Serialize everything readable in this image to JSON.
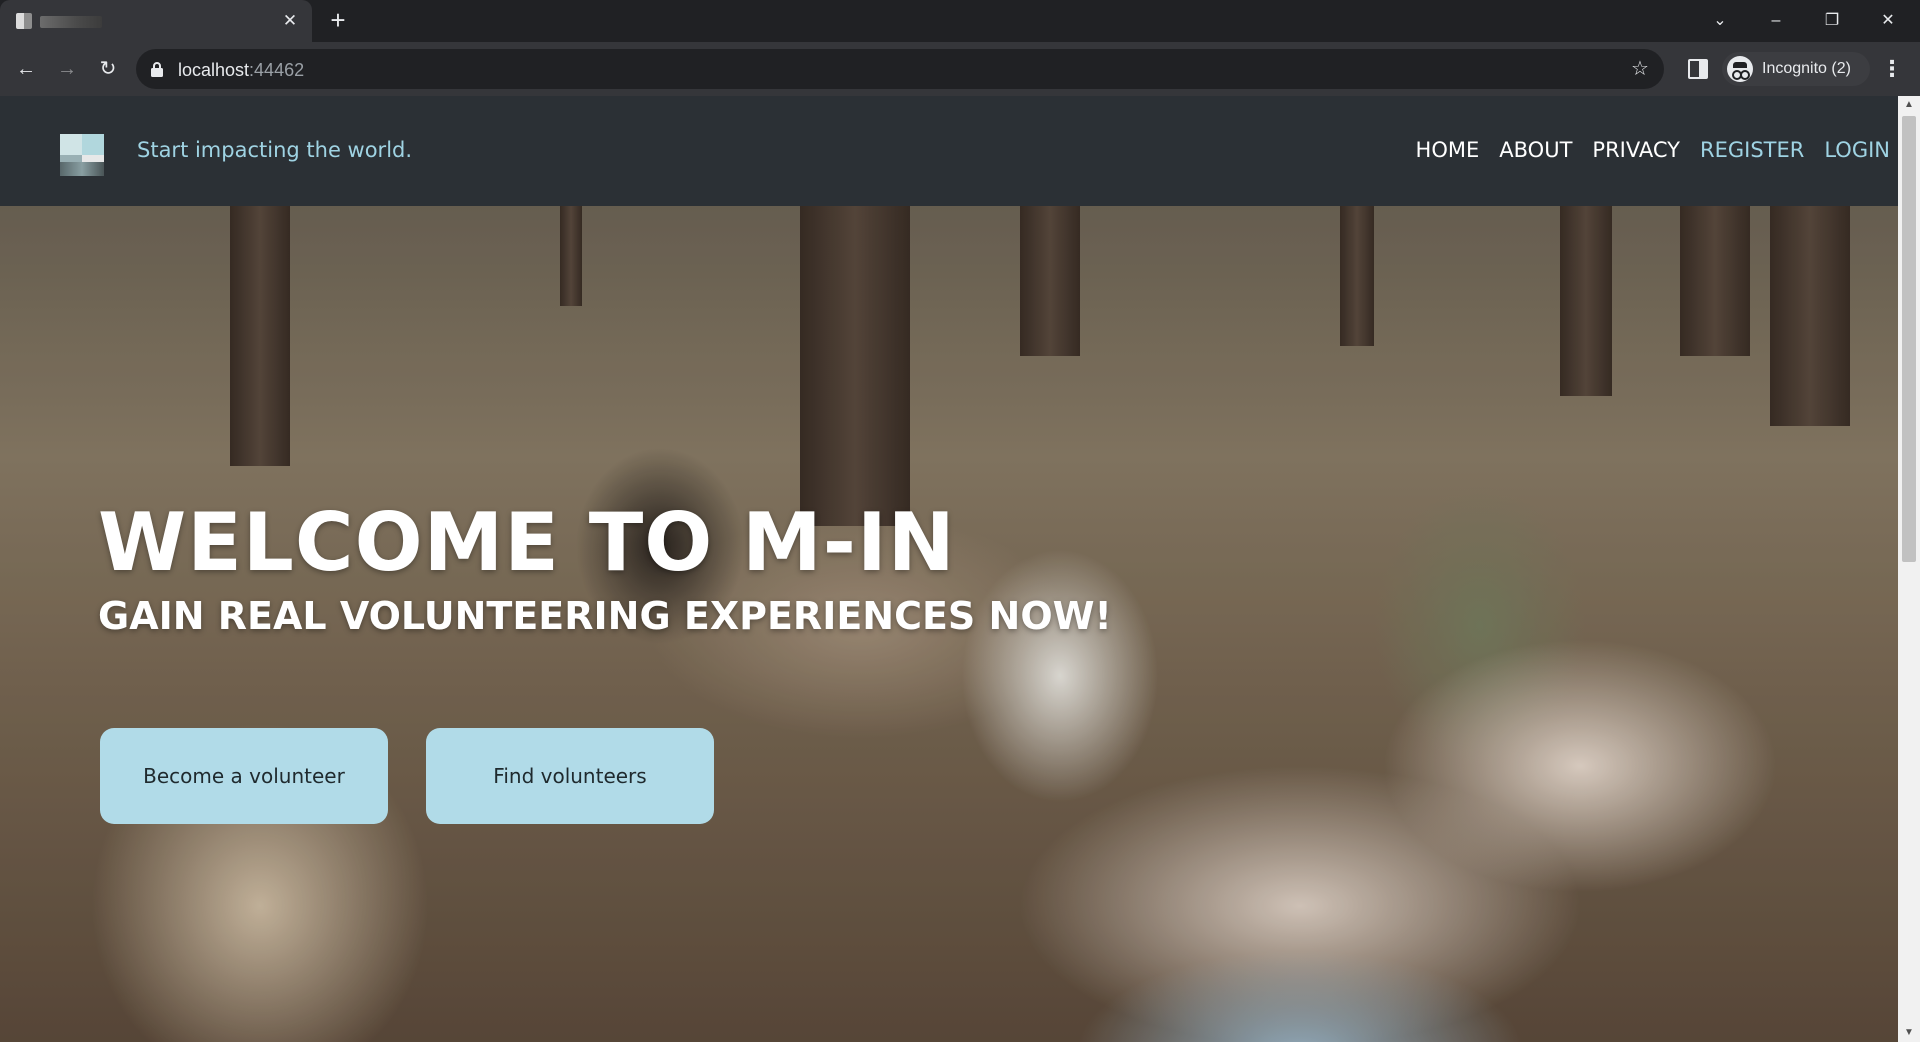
{
  "browser": {
    "tab": {
      "title": "",
      "close_icon": "close-icon"
    },
    "new_tab_icon": "plus-icon",
    "window_controls": [
      "chevron-down-icon",
      "minimize-icon",
      "restore-icon",
      "close-icon"
    ],
    "address": {
      "host": "localhost",
      "port": ":44462"
    },
    "incognito_label": "Incognito (2)"
  },
  "site": {
    "tagline": "Start impacting the world.",
    "nav": [
      {
        "label": "HOME"
      },
      {
        "label": "ABOUT"
      },
      {
        "label": "PRIVACY"
      },
      {
        "label": "REGISTER"
      },
      {
        "label": "LOGIN"
      }
    ],
    "hero": {
      "title": "WELCOME TO M-IN",
      "subtitle": "GAIN REAL VOLUNTEERING EXPERIENCES NOW!",
      "primary_button": "Become a volunteer",
      "secondary_button": "Find volunteers"
    }
  },
  "colors": {
    "navbar_bg": "#2b3035",
    "accent": "#9fd3e3",
    "button_bg": "#b1dbe8"
  }
}
